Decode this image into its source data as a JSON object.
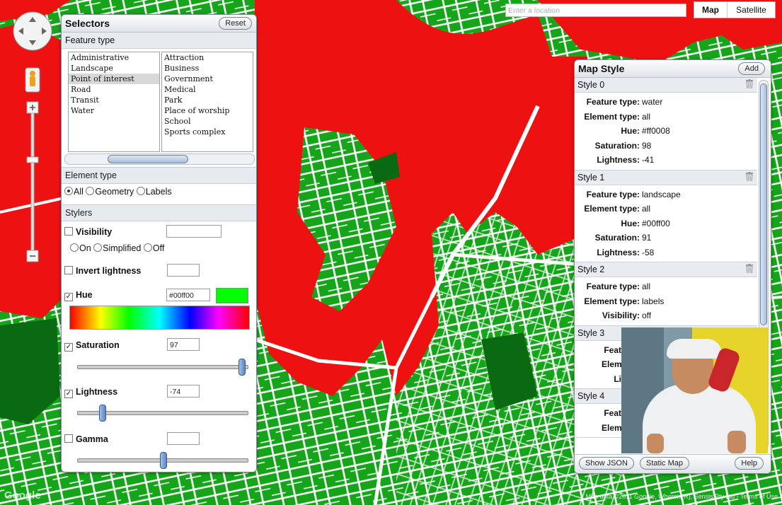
{
  "search": {
    "placeholder": "Enter a location"
  },
  "map_type": {
    "map_label": "Map",
    "satellite_label": "Satellite"
  },
  "selectors": {
    "title": "Selectors",
    "reset_label": "Reset",
    "feature_type_heading": "Feature type",
    "feature_types": [
      "Administrative",
      "Landscape",
      "Point of interest",
      "Road",
      "Transit",
      "Water"
    ],
    "feature_type_selected": "Point of interest",
    "sub_types": [
      "Attraction",
      "Business",
      "Government",
      "Medical",
      "Park",
      "Place of worship",
      "School",
      "Sports complex"
    ],
    "element_type_heading": "Element type",
    "element_types": {
      "all": "All",
      "geometry": "Geometry",
      "labels": "Labels",
      "selected": "All"
    },
    "stylers_heading": "Stylers",
    "visibility": {
      "label": "Visibility",
      "checked": false,
      "value": "",
      "options": {
        "on": "On",
        "simplified": "Simplified",
        "off": "Off"
      }
    },
    "invert_lightness": {
      "label": "Invert lightness",
      "checked": false,
      "value": ""
    },
    "hue": {
      "label": "Hue",
      "checked": true,
      "value": "#00ff00",
      "swatch": "#00ff00"
    },
    "saturation": {
      "label": "Saturation",
      "checked": true,
      "value": "97",
      "level": 97,
      "min": -100,
      "max": 100
    },
    "lightness": {
      "label": "Lightness",
      "checked": true,
      "value": "-74",
      "level": -74,
      "min": -100,
      "max": 100
    },
    "gamma": {
      "label": "Gamma",
      "checked": false,
      "value": "",
      "level": 1
    }
  },
  "map_style": {
    "title": "Map Style",
    "add_label": "Add",
    "styles": [
      {
        "header": "Style 0",
        "props": [
          {
            "k": "Feature type:",
            "v": "water"
          },
          {
            "k": "Element type:",
            "v": "all"
          },
          {
            "k": "Hue:",
            "v": "#ff0008"
          },
          {
            "k": "Saturation:",
            "v": "98"
          },
          {
            "k": "Lightness:",
            "v": "-41"
          }
        ]
      },
      {
        "header": "Style 1",
        "props": [
          {
            "k": "Feature type:",
            "v": "landscape"
          },
          {
            "k": "Element type:",
            "v": "all"
          },
          {
            "k": "Hue:",
            "v": "#00ff00"
          },
          {
            "k": "Saturation:",
            "v": "91"
          },
          {
            "k": "Lightness:",
            "v": "-58"
          }
        ]
      },
      {
        "header": "Style 2",
        "props": [
          {
            "k": "Feature type:",
            "v": "all"
          },
          {
            "k": "Element type:",
            "v": "labels"
          },
          {
            "k": "Visibility:",
            "v": "off"
          }
        ]
      },
      {
        "header": "Style 3",
        "props": [
          {
            "k": "Feature t",
            "v": ""
          },
          {
            "k": "Element t",
            "v": ""
          },
          {
            "k": "Lightn",
            "v": ""
          }
        ]
      },
      {
        "header": "Style 4",
        "props": [
          {
            "k": "Feature t",
            "v": ""
          },
          {
            "k": "Element t",
            "v": ""
          }
        ]
      }
    ],
    "show_json_label": "Show JSON",
    "static_map_label": "Static Map",
    "help_label": "Help"
  },
  "attribution": "Map data ©2011 Google, Whereis(R), Sensis Pty Ltd - Terms of Use",
  "colors": {
    "water": "#ee1111",
    "landscape": "#16a51a",
    "road": "#ffffff",
    "dark_green": "#0a6a12"
  }
}
